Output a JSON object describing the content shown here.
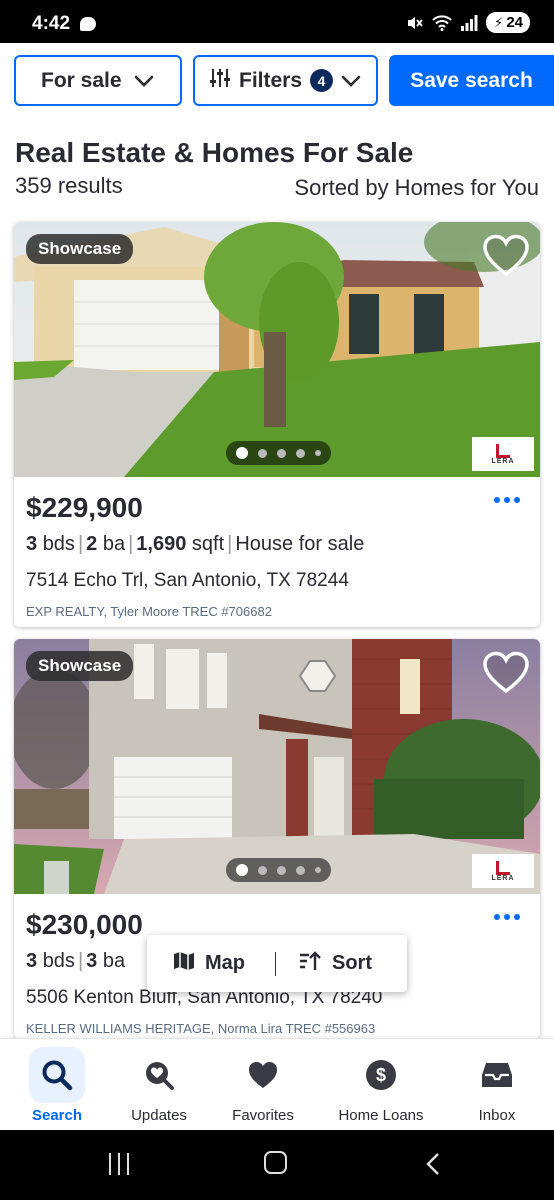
{
  "status_bar": {
    "time": "4:42",
    "battery": "24"
  },
  "toolbar": {
    "for_sale_label": "For sale",
    "filters_label": "Filters",
    "filters_count": "4",
    "save_search_label": "Save search"
  },
  "header": {
    "title": "Real Estate & Homes For Sale",
    "results": "359 results",
    "sort_label": "Sorted by Homes for You"
  },
  "listings": [
    {
      "badge": "Showcase",
      "price": "$229,900",
      "beds": "3",
      "beds_unit": "bds",
      "baths": "2",
      "baths_unit": "ba",
      "sqft": "1,690",
      "sqft_unit": "sqft",
      "type": "House for sale",
      "address": "7514 Echo Trl, San Antonio, TX 78244",
      "broker": "EXP REALTY, Tyler Moore TREC #706682",
      "logo_text": "LERA"
    },
    {
      "badge": "Showcase",
      "price": "$230,000",
      "beds": "3",
      "beds_unit": "bds",
      "baths": "3",
      "baths_unit": "ba",
      "address": "5506 Kenton Bluff, San Antonio, TX 78240",
      "broker": "KELLER WILLIAMS HERITAGE, Norma Lira TREC #556963",
      "logo_text": "LERA"
    }
  ],
  "float_actions": {
    "map_label": "Map",
    "sort_label": "Sort"
  },
  "bottom_nav": [
    {
      "label": "Search",
      "icon": "search-icon",
      "active": true
    },
    {
      "label": "Updates",
      "icon": "updates-icon"
    },
    {
      "label": "Favorites",
      "icon": "heart-icon"
    },
    {
      "label": "Home Loans",
      "icon": "dollar-icon"
    },
    {
      "label": "Inbox",
      "icon": "inbox-icon"
    }
  ],
  "colors": {
    "accent": "#006aff",
    "text": "#2a2a33",
    "badge_bg": "#0d2a5e",
    "broker_text": "#596b82"
  }
}
